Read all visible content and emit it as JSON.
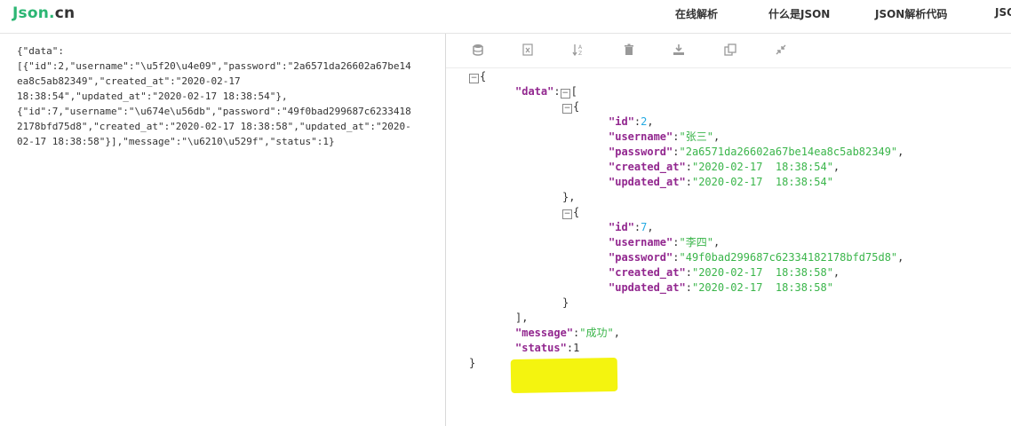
{
  "header": {
    "logo_main": "Json",
    "logo_dot": ".",
    "logo_cn": "cn",
    "nav": [
      "在线解析",
      "什么是JSON",
      "JSON解析代码",
      "JSON"
    ]
  },
  "raw_input": {
    "lines": [
      "{\"data\":",
      "[{\"id\":2,\"username\":\"\\u5f20\\u4e09\",\"password\":\"2a6571da26602a67be14",
      "ea8c5ab82349\",\"created_at\":\"2020-02-17",
      "18:38:54\",\"updated_at\":\"2020-02-17 18:38:54\"},",
      "{\"id\":7,\"username\":\"\\u674e\\u56db\",\"password\":\"49f0bad299687c6233418",
      "2178bfd75d8\",\"created_at\":\"2020-02-17 18:38:58\",\"updated_at\":\"2020-",
      "02-17 18:38:58\"}],\"message\":\"\\u6210\\u529f\",\"status\":1}"
    ]
  },
  "toolbar": {
    "icons": [
      "database-icon",
      "excel-icon",
      "sort-icon",
      "trash-icon",
      "download-icon",
      "copy-icon",
      "collapse-icon"
    ]
  },
  "tree": {
    "open_brace": "{",
    "close_brace": "}",
    "data_key": "data",
    "open_bracket": "[",
    "close_bracket": "],",
    "toggle": "−",
    "records": [
      {
        "id": "2",
        "username": "张三",
        "password": "2a6571da26602a67be14ea8c5ab82349",
        "created_at": "2020-02-17  18:38:54",
        "updated_at": "2020-02-17  18:38:54",
        "close": "},"
      },
      {
        "id": "7",
        "username": "李四",
        "password": "49f0bad299687c62334182178bfd75d8",
        "created_at": "2020-02-17  18:38:58",
        "updated_at": "2020-02-17  18:38:58",
        "close": "}"
      }
    ],
    "message_key": "message",
    "message_value": "成功",
    "status_key": "status",
    "status_value": "1",
    "keys": {
      "id": "id",
      "username": "username",
      "password": "password",
      "created_at": "created_at",
      "updated_at": "updated_at"
    }
  },
  "colors": {
    "brand": "#2bb673",
    "key": "#92278f",
    "string": "#3ab54a",
    "number": "#25aae2",
    "highlight": "#f4f40f"
  }
}
